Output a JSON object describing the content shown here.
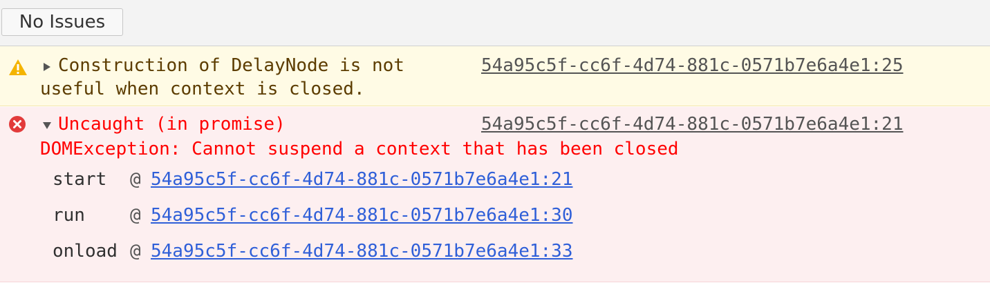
{
  "toolbar": {
    "issues_button": "No Issues"
  },
  "messages": {
    "warning": {
      "icon": "warning-icon",
      "color": "#f4b400",
      "line1": "Construction of DelayNode is not",
      "line2": "useful when context is closed.",
      "source": "54a95c5f-cc6f-4d74-881c-0571b7e6a4e1:25"
    },
    "error": {
      "icon": "error-icon",
      "color": "#e23b3b",
      "line1": "Uncaught (in promise)",
      "line2": "DOMException: Cannot suspend a context that has been closed",
      "source": "54a95c5f-cc6f-4d74-881c-0571b7e6a4e1:21",
      "stack": [
        {
          "fn": "start",
          "at": "@",
          "link": "54a95c5f-cc6f-4d74-881c-0571b7e6a4e1:21"
        },
        {
          "fn": "run",
          "at": "@",
          "link": "54a95c5f-cc6f-4d74-881c-0571b7e6a4e1:30"
        },
        {
          "fn": "onload",
          "at": "@",
          "link": "54a95c5f-cc6f-4d74-881c-0571b7e6a4e1:33"
        }
      ]
    }
  }
}
